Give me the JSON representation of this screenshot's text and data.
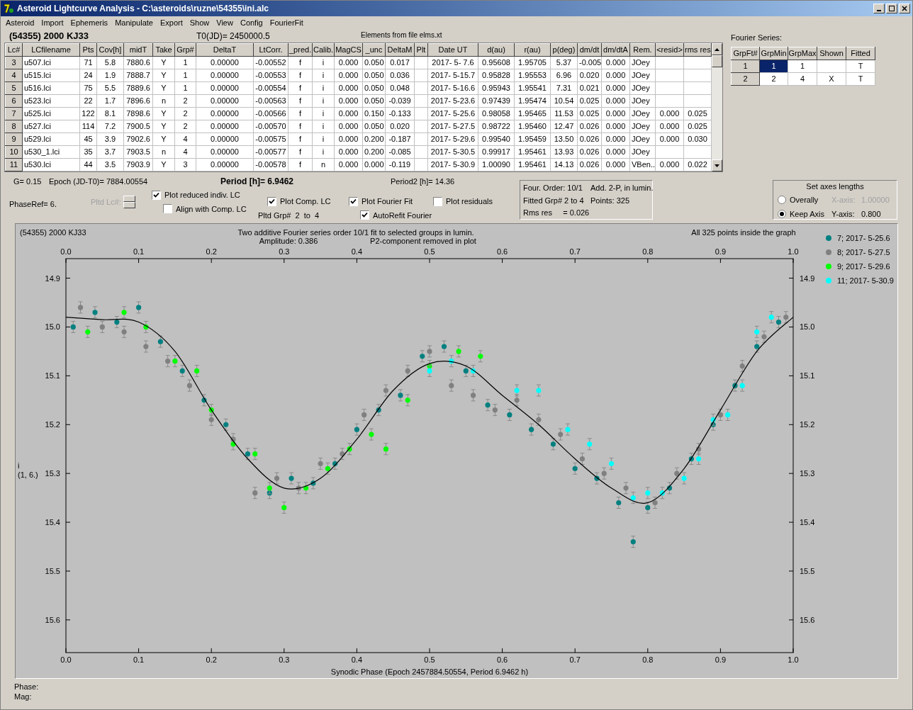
{
  "window": {
    "title": "Asteroid Lightcurve Analysis - C:\\asteroids\\ruzne\\54355\\ini.alc"
  },
  "menu": [
    "Asteroid",
    "Import",
    "Ephemeris",
    "Manipulate",
    "Export",
    "Show",
    "View",
    "Config",
    "FourierFit"
  ],
  "header": {
    "object": "(54355) 2000 KJ33",
    "t0": "T0(JD)= 2450000.5",
    "elements": "Elements from file elms.xt"
  },
  "lc_table": {
    "columns": [
      "Lc#",
      "LCfilename",
      "Pts",
      "Cov[h]",
      "midT",
      "Take",
      "Grp#",
      "DeltaT",
      "LtCorr.",
      "_pred.",
      "Calib.",
      "MagCS",
      "_unc",
      "DeltaM",
      "Plt",
      "Date UT",
      "d(au)",
      "r(au)",
      "p(deg)",
      "dm/dt",
      "dm/dtA",
      "Rem.",
      "<resid>",
      "rms res"
    ],
    "rows": [
      [
        "3",
        "u507.lci",
        "71",
        "5.8",
        "7880.6",
        "Y",
        "1",
        "0.00000",
        "-0.00552",
        "f",
        "i",
        "0.000",
        "0.050",
        "0.017",
        null,
        "2017- 5- 7.6",
        "0.95608",
        "1.95705",
        "5.37",
        "-0.005",
        "0.000",
        "JOey",
        null,
        null
      ],
      [
        "4",
        "u515.lci",
        "24",
        "1.9",
        "7888.7",
        "Y",
        "1",
        "0.00000",
        "-0.00553",
        "f",
        "i",
        "0.000",
        "0.050",
        "0.036",
        null,
        "2017- 5-15.7",
        "0.95828",
        "1.95553",
        "6.96",
        "0.020",
        "0.000",
        "JOey",
        null,
        null
      ],
      [
        "5",
        "u516.lci",
        "75",
        "5.5",
        "7889.6",
        "Y",
        "1",
        "0.00000",
        "-0.00554",
        "f",
        "i",
        "0.000",
        "0.050",
        "0.048",
        null,
        "2017- 5-16.6",
        "0.95943",
        "1.95541",
        "7.31",
        "0.021",
        "0.000",
        "JOey",
        null,
        null
      ],
      [
        "6",
        "u523.lci",
        "22",
        "1.7",
        "7896.6",
        "n",
        "2",
        "0.00000",
        "-0.00563",
        "f",
        "i",
        "0.000",
        "0.050",
        "-0.039",
        null,
        "2017- 5-23.6",
        "0.97439",
        "1.95474",
        "10.54",
        "0.025",
        "0.000",
        "JOey",
        null,
        null
      ],
      [
        "7",
        "u525.lci",
        "122",
        "8.1",
        "7898.6",
        "Y",
        "2",
        "0.00000",
        "-0.00566",
        "f",
        "i",
        "0.000",
        "0.150",
        "-0.133",
        null,
        "2017- 5-25.6",
        "0.98058",
        "1.95465",
        "11.53",
        "0.025",
        "0.000",
        "JOey",
        "0.000",
        "0.025"
      ],
      [
        "8",
        "u527.lci",
        "114",
        "7.2",
        "7900.5",
        "Y",
        "2",
        "0.00000",
        "-0.00570",
        "f",
        "i",
        "0.000",
        "0.050",
        "0.020",
        null,
        "2017- 5-27.5",
        "0.98722",
        "1.95460",
        "12.47",
        "0.026",
        "0.000",
        "JOey",
        "0.000",
        "0.025"
      ],
      [
        "9",
        "u529.lci",
        "45",
        "3.9",
        "7902.6",
        "Y",
        "4",
        "0.00000",
        "-0.00575",
        "f",
        "i",
        "0.000",
        "0.200",
        "-0.187",
        null,
        "2017- 5-29.6",
        "0.99540",
        "1.95459",
        "13.50",
        "0.026",
        "0.000",
        "JOey",
        "0.000",
        "0.030"
      ],
      [
        "10",
        "u530_1.lci",
        "35",
        "3.7",
        "7903.5",
        "n",
        "4",
        "0.00000",
        "-0.00577",
        "f",
        "i",
        "0.000",
        "0.200",
        "-0.085",
        null,
        "2017- 5-30.5",
        "0.99917",
        "1.95461",
        "13.93",
        "0.026",
        "0.000",
        "JOey",
        null,
        null
      ],
      [
        "11",
        "u530.lci",
        "44",
        "3.5",
        "7903.9",
        "Y",
        "3",
        "0.00000",
        "-0.00578",
        "f",
        "n",
        "0.000",
        "0.000",
        "-0.119",
        null,
        "2017- 5-30.9",
        "1.00090",
        "1.95461",
        "14.13",
        "0.026",
        "0.000",
        "VBen..",
        "0.000",
        "0.022"
      ]
    ]
  },
  "fourier": {
    "title": "Fourier Series:",
    "columns": [
      "GrpFt#",
      "GrpMin",
      "GrpMax",
      "Shown",
      "Fitted"
    ],
    "rows": [
      {
        "cells": [
          {
            "text": "1"
          },
          {
            "text": "1",
            "selected": true
          },
          {
            "text": "1",
            "selected": false
          },
          {
            "selected": false
          },
          {
            "text": "T",
            "selected": false
          }
        ]
      },
      {
        "cells": [
          {
            "text": "2"
          },
          {
            "text": "2",
            "selected": false
          },
          {
            "text": "4",
            "selected": false
          },
          {
            "text": "X",
            "selected": false
          },
          {
            "text": "T",
            "selected": false
          }
        ]
      }
    ]
  },
  "controls": {
    "g": "G= 0.15",
    "epoch": "Epoch (JD-T0)= 7884.00554",
    "period": "Period [h]= 6.9462",
    "period2": "Period2 [h]= 14.36",
    "phase_ref": "PhaseRef= 6.",
    "pltd_lc": {
      "label": "Pltd Lc#:",
      "disabled": true
    },
    "checkboxes": [
      {
        "label": "Plot reduced indiv. LC",
        "checked": true
      },
      {
        "label": "Align with Comp. LC",
        "checked": false
      },
      {
        "label": "Plot Comp. LC",
        "checked": true
      },
      {
        "label": "Plot Fourier Fit",
        "checked": true
      },
      {
        "label": "AutoRefit Fourier",
        "checked": true
      },
      {
        "label": "Plot residuals",
        "checked": false
      }
    ],
    "pltd_grp": "Pltd Grp#  2  to  4"
  },
  "fit_info": [
    "Four. Order: 10/1",
    "Add. 2-P, in lumin.",
    "Fitted Grp# 2 to 4",
    "Points: 325",
    "Rms res     = 0.026"
  ],
  "axes": {
    "title": "Set axes lengths",
    "options": [
      {
        "label": "Overally",
        "selected": false
      },
      {
        "label": "Keep Axis",
        "selected": true
      }
    ],
    "x_axis": {
      "label": "X-axis:",
      "value": "1.00000",
      "disabled": true
    },
    "y_axis": {
      "label": "Y-axis:",
      "value": "0.800",
      "disabled": false
    }
  },
  "plot": {
    "object": "(54355) 2000 KJ33",
    "subtitle_left": "Amplitude: 0.386",
    "subtitle_right": "P2-component removed in plot",
    "note": "All 325 points inside the graph",
    "ylabel_note": "(1, 6.)",
    "right_tick_labels": [
      "14.9",
      "15.0",
      "15.1",
      "15.2",
      "15.3",
      "15.4",
      "15.5",
      "15.6"
    ],
    "chart_data": {
      "type": "scatter",
      "title": "Two additive Fourier series order 10/1 fit to selected groups in lumin.",
      "xlabel": "Synodic Phase (Epoch 2457884.50554, Period 6.9462 h)",
      "ylabel": "i",
      "legend": true,
      "xlim": [
        0,
        1
      ],
      "ylim": [
        15.667,
        14.86
      ],
      "xticks": [
        {
          "value": 0,
          "label": "0.0"
        },
        {
          "value": 0.1,
          "label": "0.1"
        },
        {
          "value": 0.2,
          "label": "0.2"
        },
        {
          "value": 0.3,
          "label": "0.3"
        },
        {
          "value": 0.4,
          "label": "0.4"
        },
        {
          "value": 0.5,
          "label": "0.5"
        },
        {
          "value": 0.6,
          "label": "0.6"
        },
        {
          "value": 0.7,
          "label": "0.7"
        },
        {
          "value": 0.8,
          "label": "0.8"
        },
        {
          "value": 0.9,
          "label": "0.9"
        },
        {
          "value": 1,
          "label": "1.0"
        }
      ],
      "yticks": [
        {
          "value": 14.9,
          "label": "14.9"
        },
        {
          "value": 15.0,
          "label": "15.0"
        },
        {
          "value": 15.1,
          "label": "15.1"
        },
        {
          "value": 15.2,
          "label": "15.2"
        },
        {
          "value": 15.3,
          "label": "15.3"
        },
        {
          "value": 15.4,
          "label": "15.4"
        },
        {
          "value": 15.5,
          "label": "15.5"
        },
        {
          "value": 15.6,
          "label": "15.6"
        }
      ],
      "series": [
        {
          "name": "7; 2017- 5-25.6",
          "color": "#008080",
          "x": [
            0.01,
            0.04,
            0.07,
            0.1,
            0.13,
            0.16,
            0.19,
            0.22,
            0.25,
            0.28,
            0.31,
            0.34,
            0.37,
            0.4,
            0.43,
            0.46,
            0.49,
            0.52,
            0.55,
            0.58,
            0.61,
            0.64,
            0.67,
            0.7,
            0.73,
            0.76,
            0.78,
            0.8,
            0.83,
            0.86,
            0.89,
            0.92,
            0.95,
            0.98
          ],
          "values": [
            15.0,
            14.97,
            14.99,
            14.96,
            15.03,
            15.09,
            15.15,
            15.2,
            15.26,
            15.34,
            15.31,
            15.32,
            15.28,
            15.21,
            15.17,
            15.14,
            15.06,
            15.04,
            15.09,
            15.16,
            15.18,
            15.21,
            15.24,
            15.29,
            15.31,
            15.36,
            15.44,
            15.37,
            15.33,
            15.27,
            15.2,
            15.12,
            15.04,
            14.99
          ]
        },
        {
          "name": "8; 2017- 5-27.5",
          "color": "#808080",
          "x": [
            0.02,
            0.05,
            0.08,
            0.11,
            0.14,
            0.17,
            0.2,
            0.23,
            0.26,
            0.29,
            0.32,
            0.35,
            0.38,
            0.41,
            0.44,
            0.47,
            0.5,
            0.53,
            0.56,
            0.59,
            0.62,
            0.65,
            0.68,
            0.71,
            0.74,
            0.77,
            0.81,
            0.84,
            0.87,
            0.9,
            0.93,
            0.96,
            0.99
          ],
          "values": [
            14.96,
            15.0,
            15.01,
            15.04,
            15.07,
            15.12,
            15.19,
            15.23,
            15.34,
            15.31,
            15.33,
            15.28,
            15.26,
            15.18,
            15.13,
            15.09,
            15.05,
            15.12,
            15.14,
            15.17,
            15.15,
            15.19,
            15.22,
            15.27,
            15.3,
            15.33,
            15.36,
            15.3,
            15.25,
            15.18,
            15.08,
            15.02,
            14.98
          ]
        },
        {
          "name": "9; 2017- 5-29.6",
          "color": "#00ff00",
          "x": [
            0.03,
            0.08,
            0.11,
            0.15,
            0.18,
            0.2,
            0.23,
            0.26,
            0.28,
            0.3,
            0.33,
            0.36,
            0.39,
            0.42,
            0.44,
            0.47,
            0.5,
            0.54,
            0.57
          ],
          "values": [
            15.01,
            14.97,
            15.0,
            15.07,
            15.09,
            15.17,
            15.24,
            15.26,
            15.33,
            15.37,
            15.33,
            15.29,
            15.25,
            15.22,
            15.25,
            15.15,
            15.08,
            15.05,
            15.06
          ]
        },
        {
          "name": "11; 2017- 5-30.9",
          "color": "#00ffff",
          "x": [
            0.5,
            0.53,
            0.56,
            0.62,
            0.65,
            0.69,
            0.72,
            0.75,
            0.78,
            0.8,
            0.82,
            0.85,
            0.87,
            0.89,
            0.91,
            0.93,
            0.95,
            0.97
          ],
          "values": [
            15.09,
            15.07,
            15.09,
            15.13,
            15.13,
            15.21,
            15.24,
            15.28,
            15.35,
            15.34,
            15.34,
            15.31,
            15.27,
            15.19,
            15.18,
            15.12,
            15.01,
            14.98
          ]
        },
        {
          "type": "line",
          "color": "#000000",
          "x": [
            0,
            0.05,
            0.1,
            0.15,
            0.2,
            0.25,
            0.3,
            0.35,
            0.4,
            0.45,
            0.5,
            0.55,
            0.6,
            0.65,
            0.7,
            0.75,
            0.8,
            0.85,
            0.9,
            0.95,
            1.0
          ],
          "values": [
            14.98,
            14.985,
            14.99,
            15.05,
            15.17,
            15.27,
            15.33,
            15.31,
            15.23,
            15.13,
            15.075,
            15.08,
            15.14,
            15.2,
            15.27,
            15.33,
            15.36,
            15.29,
            15.17,
            15.05,
            14.98
          ]
        }
      ]
    }
  },
  "status": [
    "Phase:",
    "Mag:"
  ]
}
